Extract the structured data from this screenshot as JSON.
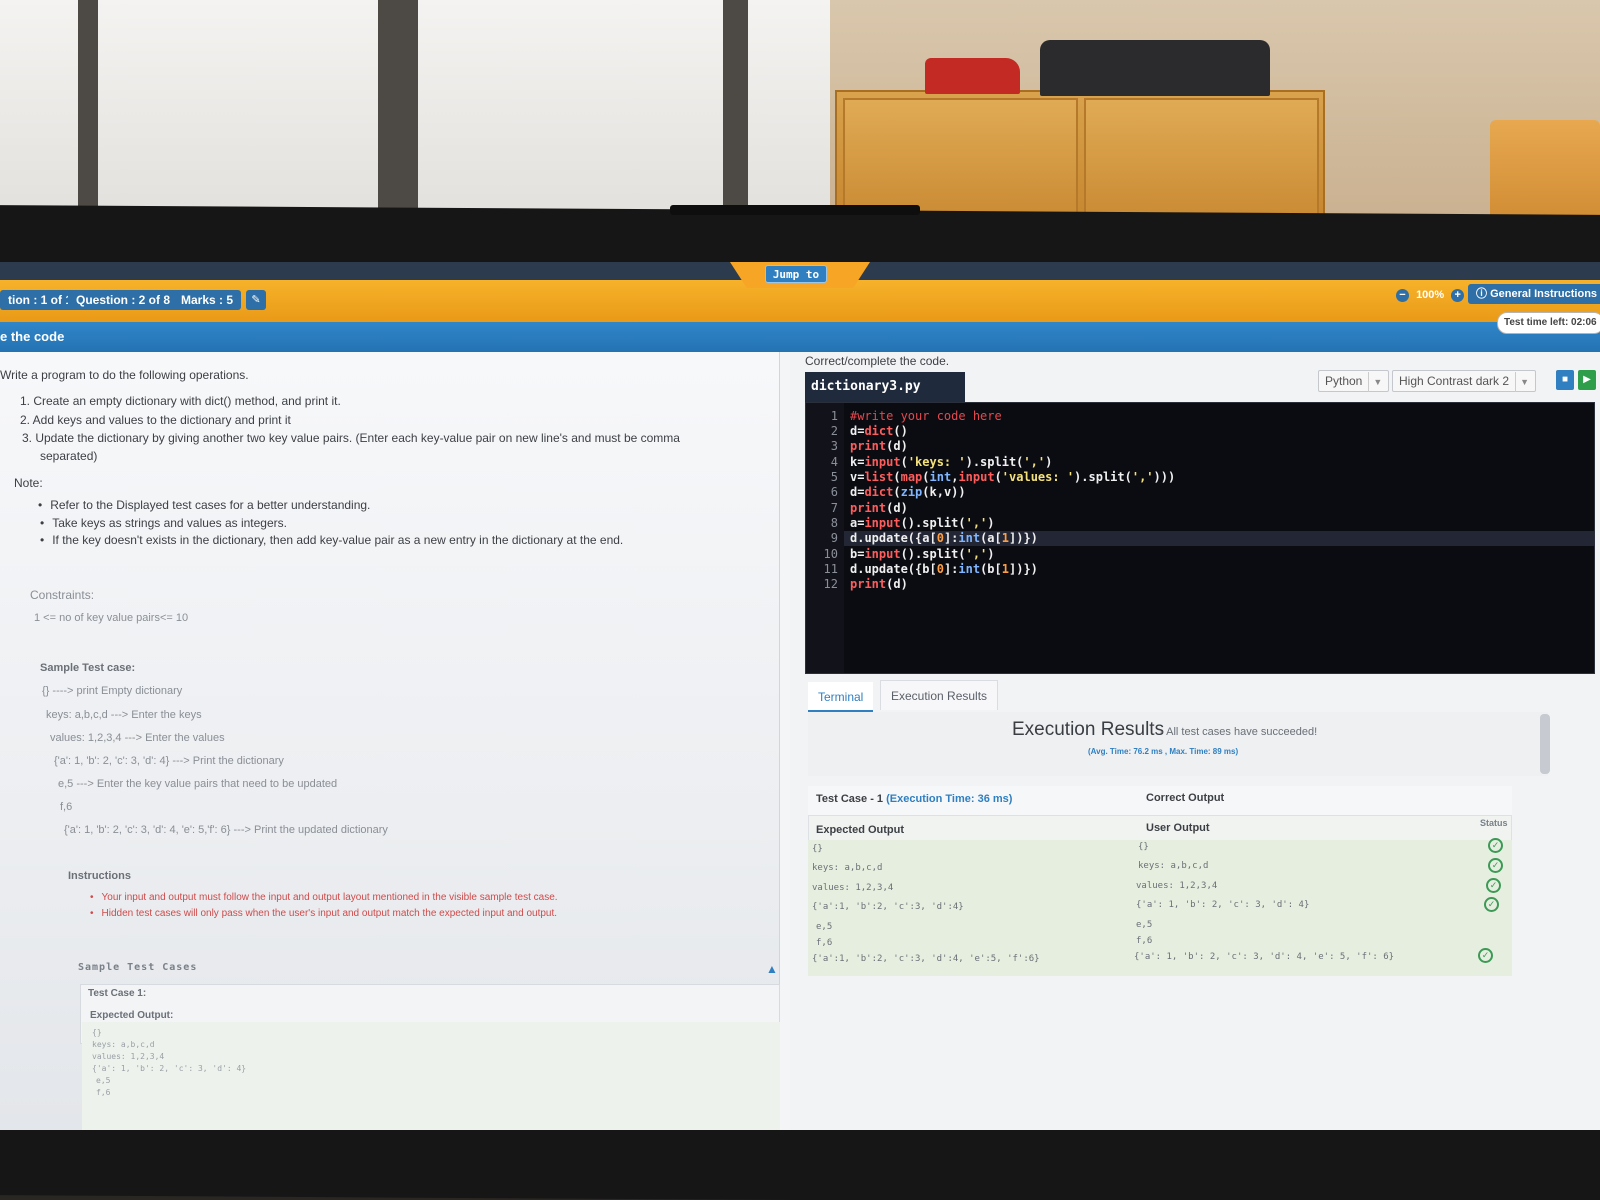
{
  "header": {
    "jump_label": "Jump to",
    "section_label": "tion : 1 of 1",
    "question_label": "Question : 2 of 8",
    "marks_label": "Marks : 5",
    "chat_icon": "chat-icon",
    "zoom_level": "100%",
    "general_instructions": "General Instructions",
    "bluebar_title": "e the code",
    "timer": "Test time left: 02:06"
  },
  "problem": {
    "intro": "Write a program to do the following operations.",
    "steps": [
      "1. Create an empty dictionary with dict() method, and print it.",
      "2. Add keys and values to the dictionary and print it",
      "3. Update the dictionary by giving another two key value pairs. (Enter each key-value pair on new line's and must be comma",
      "separated)"
    ],
    "note_label": "Note:",
    "notes": [
      "Refer to the Displayed test cases for a better understanding.",
      "Take keys as strings and values as integers.",
      "If the key doesn't exists in the dictionary, then add key-value pair as a new entry in the dictionary at the end."
    ],
    "constraints_label": "Constraints:",
    "constraints_text": "1 <= no of key value pairs<= 10",
    "sample_label": "Sample Test case:",
    "sample_lines": [
      "{} ----> print Empty dictionary",
      "keys: a,b,c,d ---> Enter the keys",
      "values: 1,2,3,4 ---> Enter the values",
      "{'a': 1, 'b': 2, 'c': 3, 'd': 4} ---> Print the dictionary",
      "e,5 ---> Enter the key value pairs that need to be updated",
      "f,6",
      "{'a': 1, 'b': 2, 'c': 3, 'd': 4, 'e': 5,'f': 6} ---> Print the updated dictionary"
    ],
    "instructions_label": "Instructions",
    "instructions": [
      "Your input and output must follow the input and output layout mentioned in the visible sample test case.",
      "Hidden test cases will only pass when the user's input and output match the expected input and output."
    ],
    "sample_cases_label": "Sample Test Cases",
    "test_case_label": "Test Case 1:",
    "expected_output_label": "Expected Output:",
    "expected_lines": [
      "{}",
      "keys: a,b,c,d",
      "values: 1,2,3,4",
      "{'a': 1, 'b': 2, 'c': 3, 'd': 4}",
      "e,5",
      "f,6"
    ]
  },
  "editor": {
    "instruction": "Correct/complete the code.",
    "filename": "dictionary3.py",
    "language": "Python",
    "theme": "High Contrast dark 2",
    "save_icon": "save-icon",
    "run_icon": "play-icon",
    "line_numbers": [
      "1",
      "2",
      "3",
      "4",
      "5",
      "6",
      "7",
      "8",
      "9",
      "10",
      "11",
      "12"
    ]
  },
  "output_tabs": {
    "terminal": "Terminal",
    "execution": "Execution Results"
  },
  "results": {
    "title": "Execution Results",
    "subtitle": "- All test cases have succeeded!",
    "timing": "(Avg. Time: 76.2 ms , Max. Time: 89 ms)",
    "test_case_label": "Test Case - 1",
    "execution_time": "(Execution Time: 36 ms)",
    "correct_output": "Correct Output",
    "expected_output": "Expected Output",
    "user_output": "User Output",
    "status": "Status",
    "expected_lines": [
      "{}",
      "keys: a,b,c,d",
      "values: 1,2,3,4",
      "{'a':1, 'b':2, 'c':3, 'd':4}",
      "e,5",
      "f,6",
      "{'a':1, 'b':2, 'c':3, 'd':4, 'e':5, 'f':6}"
    ],
    "user_lines": [
      "{}",
      "keys: a,b,c,d",
      "values: 1,2,3,4",
      "{'a': 1, 'b': 2, 'c': 3, 'd': 4}",
      "e,5",
      "f,6",
      "{'a': 1, 'b': 2, 'c': 3, 'd': 4, 'e': 5, 'f': 6}"
    ],
    "status_icon": "check-circle-icon"
  }
}
